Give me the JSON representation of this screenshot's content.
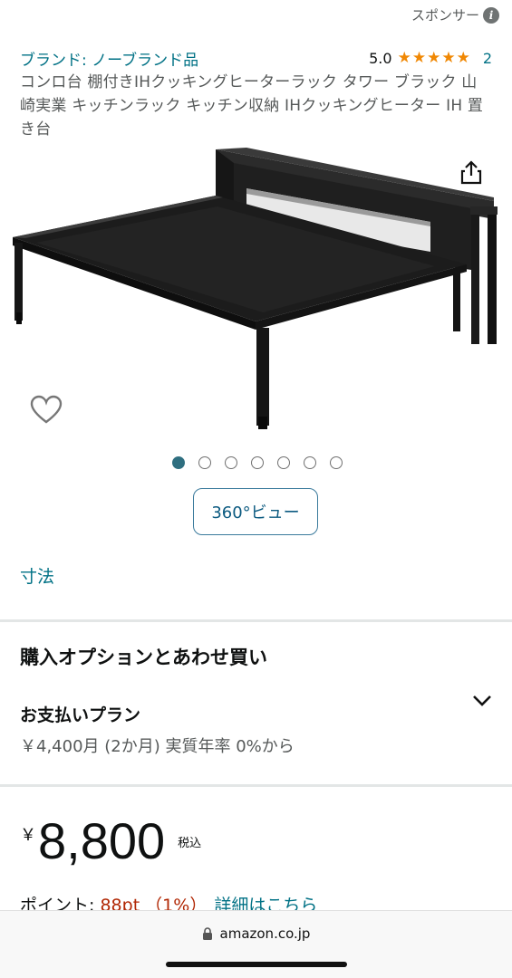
{
  "header": {
    "sponsor_label": "スポンサー",
    "info_icon_glyph": "i"
  },
  "product": {
    "brand_link": "ブランド: ノーブランド品",
    "rating_value": "5.0",
    "rating_stars": 5,
    "review_count": "2",
    "title": "コンロ台 棚付きIHクッキングヒーターラック タワー ブラック 山崎実業 キッチンラック キッチン収納 IHクッキングヒーター IH 置き台"
  },
  "gallery": {
    "image_count": 7,
    "active_index": 0,
    "view360_label": "360°ビュー",
    "dimensions_link": "寸法"
  },
  "purchase_options": {
    "heading": "購入オプションとあわせ買い",
    "plan_title": "お支払いプラン",
    "plan_detail": "￥4,400月 (2か月) 実質年率 0%から"
  },
  "pricing": {
    "currency_symbol": "￥",
    "amount": "8,800",
    "tax_label": "税込",
    "points_label": "ポイント: ",
    "points_value": "88pt （1%）",
    "points_link": "詳細はこちら"
  },
  "browser": {
    "url": "amazon.co.jp"
  },
  "colors": {
    "link": "#007185",
    "star": "#f08804",
    "points": "#b12704",
    "active_dot": "#2f6f80"
  },
  "icons": [
    "info-icon",
    "star-icon",
    "share-icon",
    "heart-icon",
    "chevron-down-icon",
    "lock-icon"
  ]
}
